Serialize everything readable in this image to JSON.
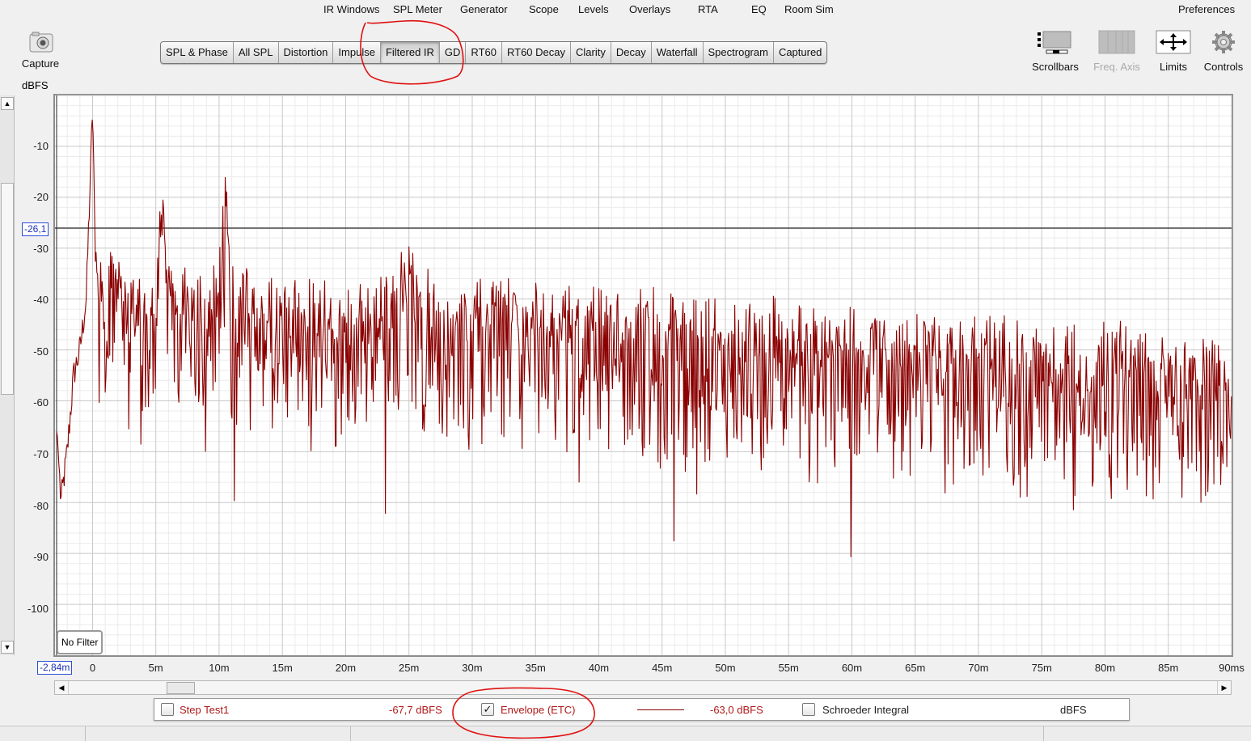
{
  "menu": [
    {
      "label": "IR Windows"
    },
    {
      "label": "SPL Meter"
    },
    {
      "label": "Generator"
    },
    {
      "label": "Scope"
    },
    {
      "label": "Levels"
    },
    {
      "label": "Overlays"
    },
    {
      "label": "RTA"
    },
    {
      "label": "EQ"
    },
    {
      "label": "Room Sim"
    }
  ],
  "preferences_label": "Preferences",
  "capture": {
    "label": "Capture",
    "icon": "camera-icon"
  },
  "tabs": [
    {
      "label": "SPL & Phase"
    },
    {
      "label": "All SPL"
    },
    {
      "label": "Distortion"
    },
    {
      "label": "Impulse"
    },
    {
      "label": "Filtered IR",
      "active": true
    },
    {
      "label": "GD"
    },
    {
      "label": "RT60"
    },
    {
      "label": "RT60 Decay"
    },
    {
      "label": "Clarity"
    },
    {
      "label": "Decay"
    },
    {
      "label": "Waterfall"
    },
    {
      "label": "Spectrogram"
    },
    {
      "label": "Captured"
    }
  ],
  "tools": [
    {
      "label": "Scrollbars",
      "icon": "scrollbars-icon",
      "enabled": true
    },
    {
      "label": "Freq. Axis",
      "icon": "freq-axis-icon",
      "enabled": false
    },
    {
      "label": "Limits",
      "icon": "limits-icon",
      "enabled": true
    },
    {
      "label": "Controls",
      "icon": "gear-icon",
      "enabled": true
    }
  ],
  "plot": {
    "y_unit": "dBFS",
    "cursor_y_value": "-26,1",
    "cursor_x_value": "-2,84m",
    "filter_label": "No Filter",
    "y_tick_labels": [
      "-10",
      "-20",
      "-30",
      "-40",
      "-50",
      "-60",
      "-70",
      "-80",
      "-90",
      "-100"
    ],
    "x_tick_labels": [
      "0",
      "5m",
      "10m",
      "15m",
      "20m",
      "25m",
      "30m",
      "35m",
      "40m",
      "45m",
      "50m",
      "55m",
      "60m",
      "65m",
      "70m",
      "75m",
      "80m",
      "85m",
      "90ms"
    ]
  },
  "chart_data": {
    "type": "line",
    "title": "",
    "xlabel": "",
    "ylabel": "dBFS",
    "xlim": [
      -2.84,
      90
    ],
    "ylim": [
      -110,
      0
    ],
    "x_unit": "ms",
    "grid": true,
    "cursor": {
      "x": -2.84,
      "y": -26.1
    },
    "series": [
      {
        "name": "Envelope (ETC)",
        "color": "#8b0000",
        "x": [
          -2.8,
          -2.5,
          -2,
          -1.5,
          -1,
          -0.5,
          -0.2,
          0,
          0.2,
          0.5,
          1,
          2,
          3,
          4,
          5,
          5.5,
          6,
          7,
          8,
          9,
          10,
          10.5,
          11,
          12,
          14,
          16,
          18,
          20,
          22,
          24,
          25,
          26,
          28,
          30,
          32,
          34,
          36,
          38,
          40,
          42,
          44,
          46,
          48,
          50,
          52,
          54,
          56,
          58,
          60,
          62,
          64,
          66,
          68,
          70,
          72,
          74,
          76,
          78,
          79,
          80,
          82,
          84,
          85,
          86,
          88,
          90
        ],
        "y": [
          -66,
          -80,
          -70,
          -55,
          -50,
          -40,
          -18,
          -2,
          -30,
          -35,
          -33,
          -32,
          -38,
          -42,
          -36,
          -16,
          -33,
          -38,
          -37,
          -40,
          -35,
          -16,
          -36,
          -38,
          -40,
          -39,
          -40,
          -42,
          -40,
          -38,
          -31,
          -38,
          -40,
          -41,
          -39,
          -40,
          -41,
          -42,
          -41,
          -43,
          -42,
          -44,
          -43,
          -44,
          -45,
          -44,
          -46,
          -45,
          -46,
          -47,
          -46,
          -47,
          -48,
          -47,
          -48,
          -49,
          -50,
          -49,
          -55,
          -48,
          -50,
          -52,
          -49,
          -52,
          -50,
          -55
        ]
      }
    ]
  },
  "legend": {
    "trace_label": "Step Test1",
    "trace_value": "-67,7 dBFS",
    "trace_checked": false,
    "envelope_label": "Envelope (ETC)",
    "envelope_checked": true,
    "envelope_value": "-63,0 dBFS",
    "schroeder_label": "Schroeder Integral",
    "schroeder_checked": false,
    "schroeder_value": "dBFS"
  },
  "colors": {
    "trace": "#8b0000",
    "annotation": "#e01010",
    "cursor_box": "#2d4fd6"
  }
}
